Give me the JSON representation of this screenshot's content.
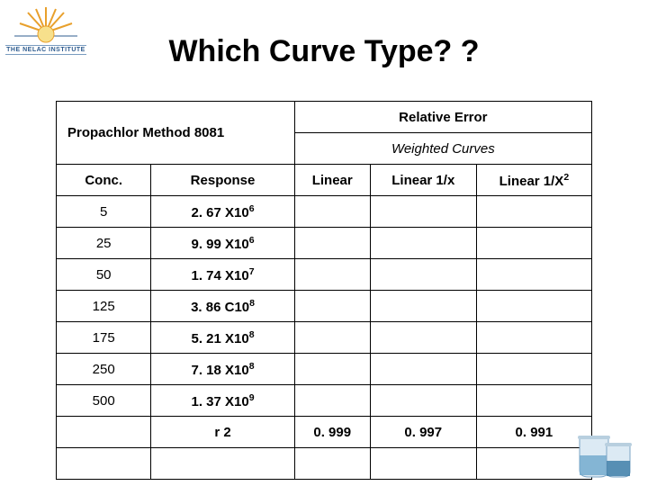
{
  "logo_text": "THE NELAC INSTITUTE",
  "title": "Which Curve Type? ?",
  "top_left_label": "Propachlor Method 8081",
  "rel_err": "Relative Error",
  "weighted": "Weighted Curves",
  "columns": {
    "conc": "Conc.",
    "response": "Response",
    "linear": "Linear",
    "lin1x": "Linear 1/x",
    "lin1x2_a": "Linear 1/X",
    "lin1x2_sup": "2"
  },
  "rows": [
    {
      "conc": "5",
      "resp_a": "2. 67 X10",
      "resp_sup": "6"
    },
    {
      "conc": "25",
      "resp_a": "9. 99 X10",
      "resp_sup": "6"
    },
    {
      "conc": "50",
      "resp_a": "1. 74 X10",
      "resp_sup": "7"
    },
    {
      "conc": "125",
      "resp_a": "3. 86 C10",
      "resp_sup": "8"
    },
    {
      "conc": "175",
      "resp_a": "5. 21 X10",
      "resp_sup": "8"
    },
    {
      "conc": "250",
      "resp_a": "7. 18 X10",
      "resp_sup": "8"
    },
    {
      "conc": "500",
      "resp_a": "1. 37 X10",
      "resp_sup": "9"
    }
  ],
  "r2_label": "r 2",
  "r2": {
    "linear": "0. 999",
    "lin1x": "0. 997",
    "lin1x2": "0. 991"
  }
}
